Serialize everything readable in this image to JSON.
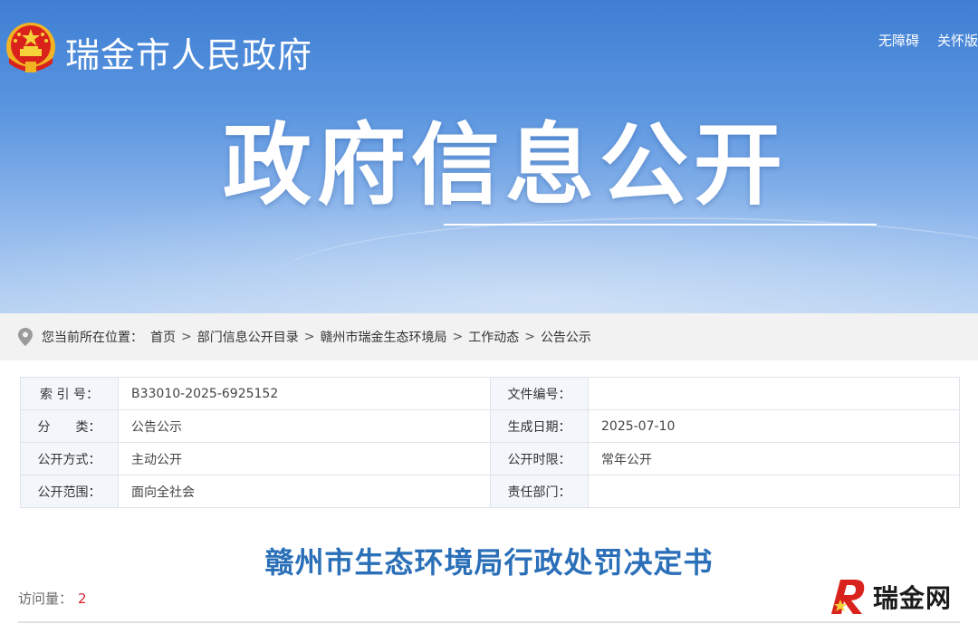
{
  "header": {
    "site_name": "瑞金市人民政府",
    "links": [
      "无障碍",
      "关怀版"
    ],
    "banner_title": "政府信息公开"
  },
  "breadcrumb": {
    "prefix": "您当前所在位置：",
    "items": [
      "首页",
      "部门信息公开目录",
      "赣州市瑞金生态环境局",
      "工作动态",
      "公告公示"
    ],
    "separator": ">"
  },
  "info": {
    "rows": [
      {
        "label1": "索 引 号：",
        "value1": "B33010-2025-6925152",
        "label2": "文件编号：",
        "value2": ""
      },
      {
        "label1": "分　　类：",
        "value1": "公告公示",
        "label2": "生成日期：",
        "value2": "2025-07-10"
      },
      {
        "label1": "公开方式：",
        "value1": "主动公开",
        "label2": "公开时限：",
        "value2": "常年公开"
      },
      {
        "label1": "公开范围：",
        "value1": "面向全社会",
        "label2": "责任部门：",
        "value2": ""
      }
    ]
  },
  "document": {
    "title": "赣州市生态环境局行政处罚决定书",
    "visits_label": "访问量：",
    "visits_count": "2"
  },
  "watermark": {
    "text": "瑞金网"
  },
  "colors": {
    "banner_top": "#3f7ed3",
    "title_blue": "#2a6fb8",
    "visit_red": "#d2232a"
  }
}
